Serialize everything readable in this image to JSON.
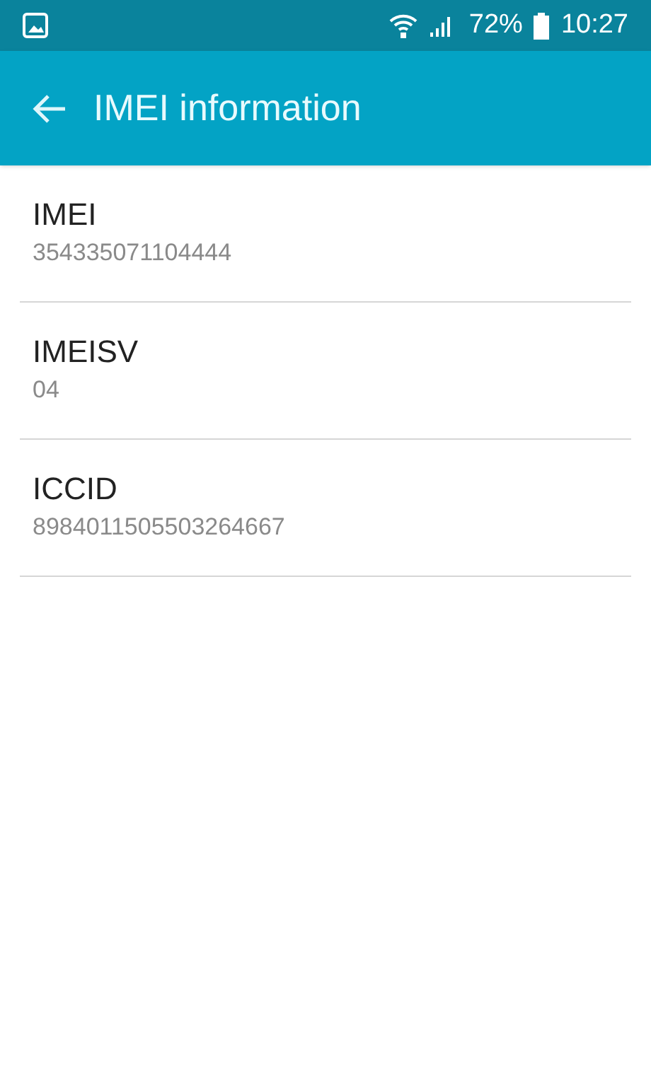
{
  "status_bar": {
    "battery": "72%",
    "time": "10:27"
  },
  "app_bar": {
    "title": "IMEI information"
  },
  "items": [
    {
      "label": "IMEI",
      "value": "354335071104444"
    },
    {
      "label": "IMEISV",
      "value": "04"
    },
    {
      "label": "ICCID",
      "value": "8984011505503264667"
    }
  ]
}
